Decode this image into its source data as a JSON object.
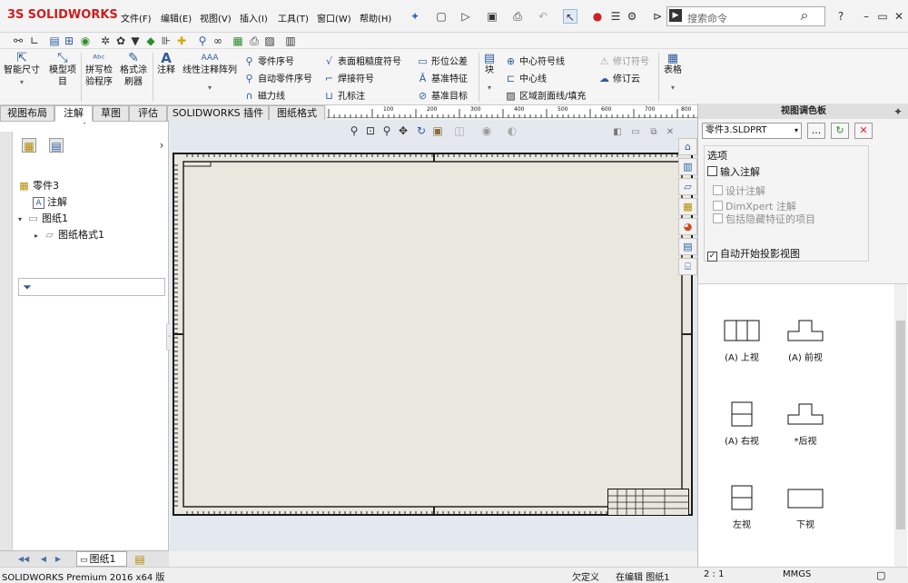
{
  "app": {
    "logo_prefix": "3S",
    "logo_text": "SOLIDWORKS"
  },
  "menu": [
    "文件(F)",
    "编辑(E)",
    "视图(V)",
    "插入(I)",
    "工具(T)",
    "窗口(W)",
    "帮助(H)"
  ],
  "search": {
    "placeholder": "搜索命令"
  },
  "ribbon": {
    "smart_dim": "智能尺寸",
    "model_items": "模型项目",
    "spell_check": "拼写检验程序",
    "format_painter": "格式涂刷器",
    "note": "注释",
    "linear_note_pattern": "线性注释阵列",
    "balloon": "零件序号",
    "auto_balloon": "自动零件序号",
    "magnetic_line": "磁力线",
    "surface_finish": "表面粗糙度符号",
    "weld_symbol": "焊接符号",
    "hole_callout": "孔标注",
    "geometric_tolerance": "形位公差",
    "datum_feature": "基准特征",
    "datum_target": "基准目标",
    "block": "块",
    "center_mark": "中心符号线",
    "centerline": "中心线",
    "area_hatch": "区域剖面线/填充",
    "revision_symbol": "修订符号",
    "revision_cloud": "修订云",
    "table": "表格"
  },
  "tabs": [
    "视图布局",
    "注解",
    "草图",
    "评估",
    "SOLIDWORKS 插件",
    "图纸格式"
  ],
  "active_tab": "注解",
  "tree": {
    "part": "零件3",
    "annotations": "注解",
    "sheet": "图纸1",
    "sheet_format": "图纸格式1"
  },
  "ruler_labels": [
    "100",
    "200",
    "300",
    "400",
    "500",
    "600",
    "700",
    "800"
  ],
  "right_panel": {
    "title": "视图调色板",
    "file": "零件3.SLDPRT",
    "browse": "...",
    "options_title": "选项",
    "import_annotations": "输入注解",
    "design_annotations": "设计注解",
    "dimxpert": "DimXpert 注解",
    "hidden_features": "包括隐藏特征的项目",
    "auto_projected": "自动开始投影视图",
    "views": [
      {
        "label": "(A) 上视"
      },
      {
        "label": "(A) 前视"
      },
      {
        "label": "(A) 右视"
      },
      {
        "label": "*后视"
      },
      {
        "label": "左视"
      },
      {
        "label": "下视"
      }
    ]
  },
  "sheet_tab": "图纸1",
  "status": {
    "product": "SOLIDWORKS Premium 2016 x64 版",
    "underdefined": "欠定义",
    "editing": "在编辑 图纸1",
    "scale": "2 : 1",
    "units": "MMGS"
  }
}
